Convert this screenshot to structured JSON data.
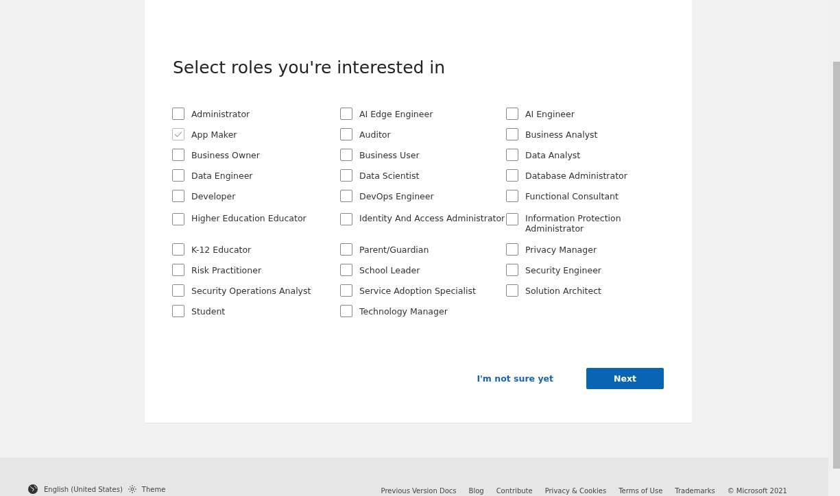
{
  "title": "Select roles you're interested in",
  "roles": [
    {
      "label": "Administrator",
      "checked": false
    },
    {
      "label": "AI Edge Engineer",
      "checked": false
    },
    {
      "label": "AI Engineer",
      "checked": false
    },
    {
      "label": "App Maker",
      "checked": true
    },
    {
      "label": "Auditor",
      "checked": false
    },
    {
      "label": "Business Analyst",
      "checked": false
    },
    {
      "label": "Business Owner",
      "checked": false
    },
    {
      "label": "Business User",
      "checked": false
    },
    {
      "label": "Data Analyst",
      "checked": false
    },
    {
      "label": "Data Engineer",
      "checked": false
    },
    {
      "label": "Data Scientist",
      "checked": false
    },
    {
      "label": "Database Administrator",
      "checked": false
    },
    {
      "label": "Developer",
      "checked": false
    },
    {
      "label": "DevOps Engineer",
      "checked": false
    },
    {
      "label": "Functional Consultant",
      "checked": false
    },
    {
      "label": "Higher Education Educator",
      "checked": false
    },
    {
      "label": "Identity And Access Administrator",
      "checked": false
    },
    {
      "label": "Information Protection Administrator",
      "checked": false
    },
    {
      "label": "K-12 Educator",
      "checked": false
    },
    {
      "label": "Parent/Guardian",
      "checked": false
    },
    {
      "label": "Privacy Manager",
      "checked": false
    },
    {
      "label": "Risk Practitioner",
      "checked": false
    },
    {
      "label": "School Leader",
      "checked": false
    },
    {
      "label": "Security Engineer",
      "checked": false
    },
    {
      "label": "Security Operations Analyst",
      "checked": false
    },
    {
      "label": "Service Adoption Specialist",
      "checked": false
    },
    {
      "label": "Solution Architect",
      "checked": false
    },
    {
      "label": "Student",
      "checked": false
    },
    {
      "label": "Technology Manager",
      "checked": false
    }
  ],
  "skip_link": "I'm not sure yet",
  "next_button": "Next",
  "footer": {
    "locale": "English (United States)",
    "theme": "Theme",
    "links": [
      "Previous Version Docs",
      "Blog",
      "Contribute",
      "Privacy & Cookies",
      "Terms of Use",
      "Trademarks",
      "© Microsoft 2021"
    ]
  }
}
